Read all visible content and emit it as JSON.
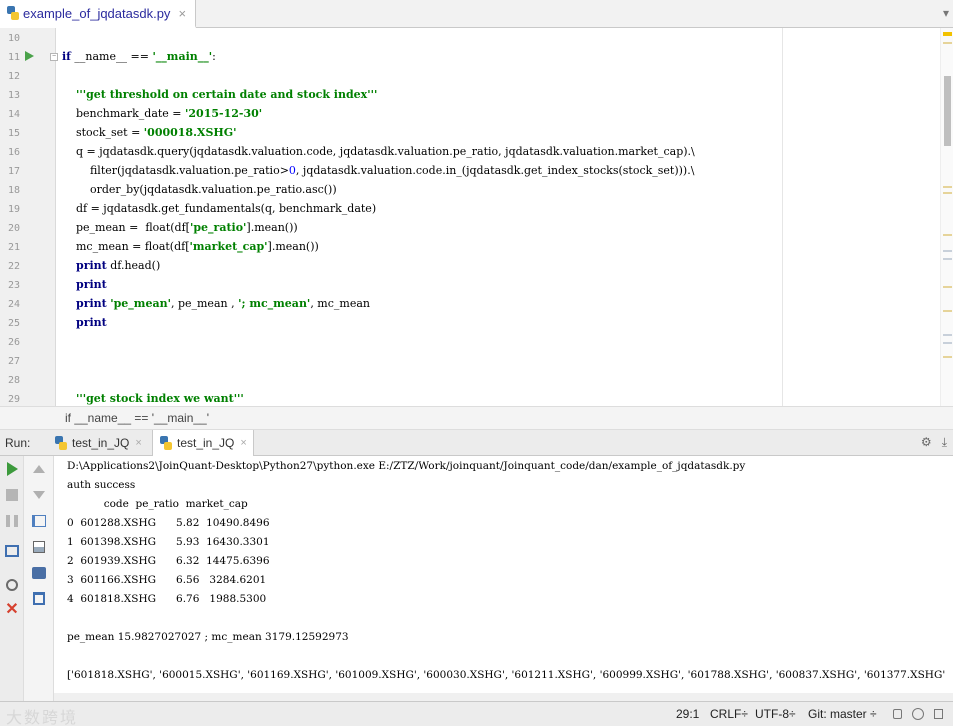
{
  "editor_tab": {
    "filename": "example_of_jqdatasdk.py",
    "close": "×"
  },
  "editor": {
    "lines": [
      {
        "no": "10",
        "segments": []
      },
      {
        "no": "11",
        "segments": [
          {
            "t": "if",
            "c": "kw"
          },
          {
            "t": " __name__ == ",
            "c": ""
          },
          {
            "t": "'__main__'",
            "c": "str"
          },
          {
            "t": ":",
            "c": ""
          }
        ]
      },
      {
        "no": "12",
        "segments": []
      },
      {
        "no": "13",
        "segments": [
          {
            "t": "    ",
            "c": ""
          },
          {
            "t": "'''get threshold on certain date and stock index'''",
            "c": "str"
          }
        ]
      },
      {
        "no": "14",
        "segments": [
          {
            "t": "    benchmark_date = ",
            "c": ""
          },
          {
            "t": "'2015-12-30'",
            "c": "str"
          }
        ]
      },
      {
        "no": "15",
        "segments": [
          {
            "t": "    stock_set = ",
            "c": ""
          },
          {
            "t": "'000018.XSHG'",
            "c": "str"
          }
        ]
      },
      {
        "no": "16",
        "segments": [
          {
            "t": "    q = jqdatasdk.query(jqdatasdk.valuation.code, jqdatasdk.valuation.pe_ratio, jqdatasdk.valuation.market_cap).\\",
            "c": ""
          }
        ]
      },
      {
        "no": "17",
        "segments": [
          {
            "t": "        filter(jqdatasdk.valuation.pe_ratio>",
            "c": ""
          },
          {
            "t": "0",
            "c": "num"
          },
          {
            "t": ", jqdatasdk.valuation.code.in_(jqdatasdk.get_index_stocks(stock_set))).\\",
            "c": ""
          }
        ]
      },
      {
        "no": "18",
        "segments": [
          {
            "t": "        order_by(jqdatasdk.valuation.pe_ratio.asc())",
            "c": ""
          }
        ]
      },
      {
        "no": "19",
        "segments": [
          {
            "t": "    df = jqdatasdk.get_fundamentals(q, benchmark_date)",
            "c": ""
          }
        ]
      },
      {
        "no": "20",
        "segments": [
          {
            "t": "    pe_mean =  float(df[",
            "c": ""
          },
          {
            "t": "'pe_ratio'",
            "c": "str"
          },
          {
            "t": "].mean())",
            "c": ""
          }
        ]
      },
      {
        "no": "21",
        "segments": [
          {
            "t": "    mc_mean = float(df[",
            "c": ""
          },
          {
            "t": "'market_cap'",
            "c": "str"
          },
          {
            "t": "].mean())",
            "c": ""
          }
        ]
      },
      {
        "no": "22",
        "segments": [
          {
            "t": "    ",
            "c": ""
          },
          {
            "t": "print",
            "c": "kw"
          },
          {
            "t": " df.head()",
            "c": ""
          }
        ]
      },
      {
        "no": "23",
        "segments": [
          {
            "t": "    ",
            "c": ""
          },
          {
            "t": "print",
            "c": "kw"
          }
        ]
      },
      {
        "no": "24",
        "segments": [
          {
            "t": "    ",
            "c": ""
          },
          {
            "t": "print",
            "c": "kw"
          },
          {
            "t": " ",
            "c": ""
          },
          {
            "t": "'pe_mean'",
            "c": "str"
          },
          {
            "t": ", pe_mean , ",
            "c": ""
          },
          {
            "t": "'; mc_mean'",
            "c": "str"
          },
          {
            "t": ", mc_mean",
            "c": ""
          }
        ]
      },
      {
        "no": "25",
        "segments": [
          {
            "t": "    ",
            "c": ""
          },
          {
            "t": "print",
            "c": "kw"
          }
        ]
      },
      {
        "no": "26",
        "segments": []
      },
      {
        "no": "27",
        "segments": []
      },
      {
        "no": "28",
        "segments": []
      },
      {
        "no": "29",
        "segments": [
          {
            "t": "    ",
            "c": ""
          },
          {
            "t": "'''get stock index we want'''",
            "c": "str"
          }
        ]
      }
    ]
  },
  "breadcrumb": "if __name__ == '__main__'",
  "run_panel": {
    "title": "Run:",
    "tabs": [
      {
        "label": "test_in_JQ",
        "close": "×"
      },
      {
        "label": "test_in_JQ",
        "close": "×"
      }
    ],
    "gear": "⚙",
    "pin": "⤓"
  },
  "console": {
    "lines": [
      "D:\\Applications2\\JoinQuant-Desktop\\Python27\\python.exe E:/ZTZ/Work/joinquant/Joinquant_code/dan/example_of_jqdatasdk.py",
      "auth success",
      "           code  pe_ratio  market_cap",
      "0  601288.XSHG      5.82  10490.8496",
      "1  601398.XSHG      5.93  16430.3301",
      "2  601939.XSHG      6.32  14475.6396",
      "3  601166.XSHG      6.56   3284.6201",
      "4  601818.XSHG      6.76   1988.5300",
      "",
      "pe_mean 15.9827027027 ; mc_mean 3179.12592973",
      "",
      "['601818.XSHG', '600015.XSHG', '601169.XSHG', '601009.XSHG', '600030.XSHG', '601211.XSHG', '600999.XSHG', '601788.XSHG', '600837.XSHG', '601377.XSHG'"
    ]
  },
  "statusbar": {
    "watermark": "大数跨境",
    "position": "29:1",
    "line_sep": "CRLF÷",
    "encoding": "UTF-8÷",
    "vcs": "Git: master ÷"
  }
}
